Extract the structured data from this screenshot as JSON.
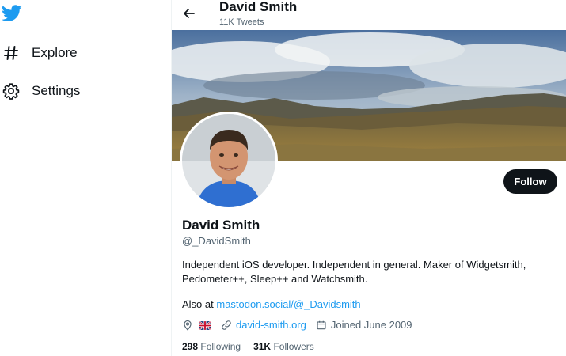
{
  "nav": {
    "explore_label": "Explore",
    "settings_label": "Settings"
  },
  "header": {
    "name": "David Smith",
    "tweet_count": "11K Tweets"
  },
  "profile": {
    "display_name": "David Smith",
    "handle": "@_DavidSmith",
    "bio_line1": "Independent iOS developer. Independent in general.  Maker of Widgetsmith,",
    "bio_line2": "Pedometer++, Sleep++ and Watchsmith.",
    "also_prefix": "Also at ",
    "also_link": "mastodon.social/@_Davidsmith",
    "website": "david-smith.org",
    "joined": "Joined June 2009",
    "following_count": "298",
    "following_label": "Following",
    "followers_count": "31K",
    "followers_label": "Followers",
    "follow_button": "Follow"
  },
  "colors": {
    "accent": "#1d9bf0",
    "text_primary": "#0f1419",
    "text_secondary": "#536471",
    "button_bg": "#0f1419"
  },
  "icons": {
    "logo": "twitter-bird-icon",
    "explore": "hashtag-icon",
    "settings": "gear-icon",
    "back": "arrow-left-icon",
    "location": "location-pin-icon",
    "flag": "uk-flag-icon",
    "link": "link-icon",
    "calendar": "calendar-icon"
  }
}
